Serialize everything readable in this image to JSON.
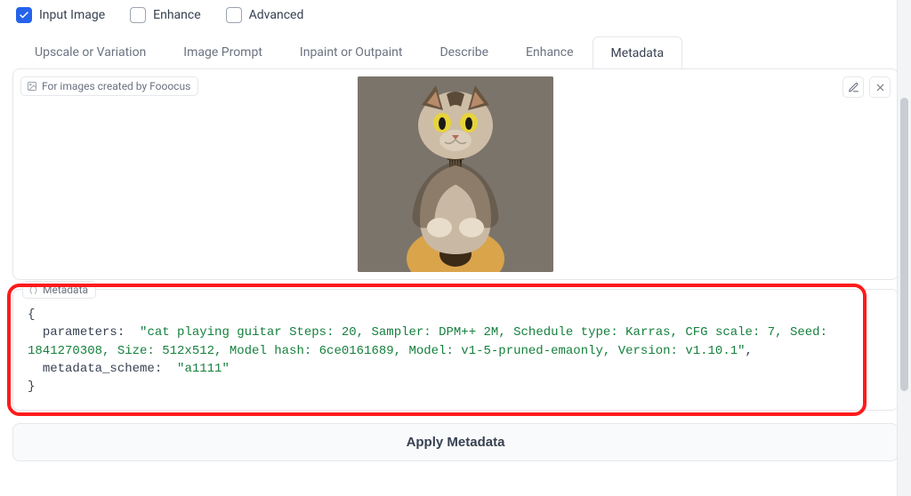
{
  "checkboxes": {
    "input_image": {
      "label": "Input Image",
      "checked": true
    },
    "enhance": {
      "label": "Enhance",
      "checked": false
    },
    "advanced": {
      "label": "Advanced",
      "checked": false
    }
  },
  "tabs": {
    "items": [
      {
        "id": "upscale",
        "label": "Upscale or Variation"
      },
      {
        "id": "prompt",
        "label": "Image Prompt"
      },
      {
        "id": "inpaint",
        "label": "Inpaint or Outpaint"
      },
      {
        "id": "describe",
        "label": "Describe"
      },
      {
        "id": "enhance",
        "label": "Enhance"
      },
      {
        "id": "metadata",
        "label": "Metadata"
      }
    ],
    "active": "metadata"
  },
  "image_panel": {
    "caption": "For images created by Fooocus",
    "actions": {
      "edit": "edit",
      "remove": "remove"
    }
  },
  "metadata_panel": {
    "label": "Metadata",
    "json": {
      "open": "{",
      "k_params": "parameters:",
      "v_params": "\"cat playing guitar Steps: 20, Sampler: DPM++ 2M, Schedule type: Karras, CFG scale: 7, Seed: 1841270308, Size: 512x512, Model hash: 6ce0161689, Model: v1-5-pruned-emaonly, Version: v1.10.1\"",
      "comma": ",",
      "k_scheme": "metadata_scheme:",
      "v_scheme": "\"a1111\"",
      "close": "}"
    }
  },
  "apply_button": {
    "label": "Apply Metadata"
  }
}
